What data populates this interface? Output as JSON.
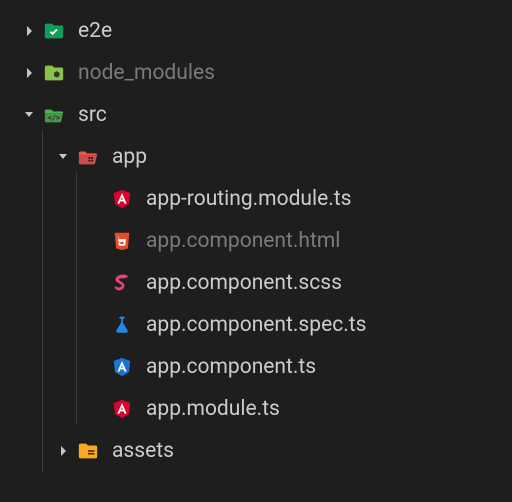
{
  "tree": {
    "nodes": [
      {
        "id": "e2e",
        "label": "e2e",
        "depth": 0,
        "expandable": true,
        "expanded": false,
        "iconKey": "folder-e2e",
        "muted": false
      },
      {
        "id": "node_modules",
        "label": "node_modules",
        "depth": 0,
        "expandable": true,
        "expanded": false,
        "iconKey": "folder-node",
        "muted": true
      },
      {
        "id": "src",
        "label": "src",
        "depth": 0,
        "expandable": true,
        "expanded": true,
        "iconKey": "folder-src",
        "muted": false
      },
      {
        "id": "app",
        "label": "app",
        "depth": 1,
        "expandable": true,
        "expanded": true,
        "iconKey": "folder-app",
        "muted": false
      },
      {
        "id": "app-routing",
        "label": "app-routing.module.ts",
        "depth": 2,
        "expandable": false,
        "expanded": false,
        "iconKey": "angular",
        "muted": false
      },
      {
        "id": "app-comp-html",
        "label": "app.component.html",
        "depth": 2,
        "expandable": false,
        "expanded": false,
        "iconKey": "html5",
        "muted": true
      },
      {
        "id": "app-comp-scss",
        "label": "app.component.scss",
        "depth": 2,
        "expandable": false,
        "expanded": false,
        "iconKey": "sass",
        "muted": false
      },
      {
        "id": "app-comp-spec",
        "label": "app.component.spec.ts",
        "depth": 2,
        "expandable": false,
        "expanded": false,
        "iconKey": "test-flask",
        "muted": false
      },
      {
        "id": "app-comp-ts",
        "label": "app.component.ts",
        "depth": 2,
        "expandable": false,
        "expanded": false,
        "iconKey": "angular-ts",
        "muted": false
      },
      {
        "id": "app-module",
        "label": "app.module.ts",
        "depth": 2,
        "expandable": false,
        "expanded": false,
        "iconKey": "angular",
        "muted": false
      },
      {
        "id": "assets",
        "label": "assets",
        "depth": 1,
        "expandable": true,
        "expanded": false,
        "iconKey": "folder-assets",
        "muted": false
      }
    ]
  },
  "icons": {
    "folder-e2e": {
      "color": "#0f9d58",
      "shape": "folder-check"
    },
    "folder-node": {
      "color": "#8bc34a",
      "shape": "folder-hex"
    },
    "folder-src": {
      "color": "#4caf50",
      "shape": "folder-code-open"
    },
    "folder-app": {
      "color": "#ef5350",
      "shape": "folder-grid-open"
    },
    "angular": {
      "color": "#dd0031",
      "shape": "angular-shield"
    },
    "angular-ts": {
      "color": "#1976d2",
      "shape": "angular-shield"
    },
    "html5": {
      "color": "#e44d26",
      "shape": "html5-shield"
    },
    "sass": {
      "color": "#ec407a",
      "shape": "sass-s"
    },
    "test-flask": {
      "color": "#1e88e5",
      "shape": "flask"
    },
    "folder-assets": {
      "color": "#f9a825",
      "shape": "folder-list"
    }
  },
  "layout": {
    "baseIndent": 16,
    "indentStep": 34,
    "twistieWidth": 26,
    "guideOffsets": [
      26,
      60
    ]
  }
}
